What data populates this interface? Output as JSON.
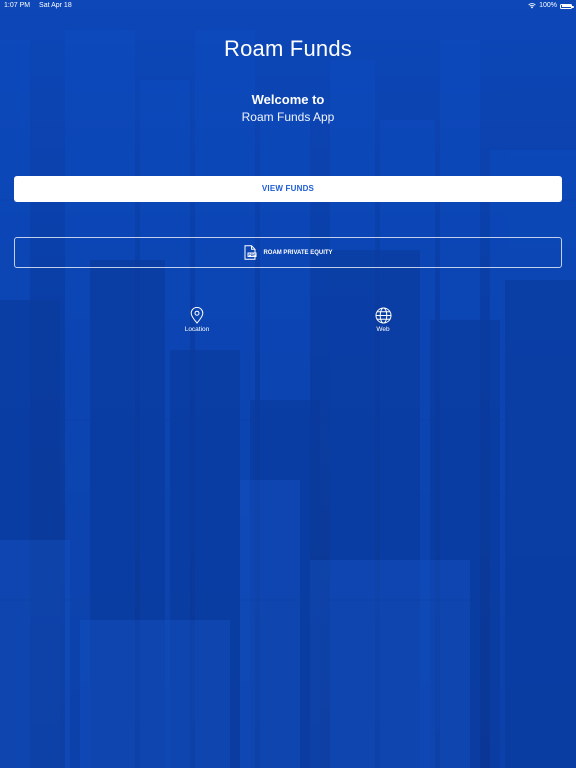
{
  "status_bar": {
    "time": "1:07 PM",
    "date": "Sat Apr 18",
    "battery": "100%"
  },
  "app": {
    "logo_text": "Roam Funds",
    "welcome": "Welcome to",
    "subtitle": "Roam Funds App"
  },
  "actions": {
    "view_funds": "VIEW FUNDS",
    "private_equity": "ROAM PRIVATE EQUITY"
  },
  "quick_links": {
    "location": "Location",
    "web": "Web"
  },
  "icons": {
    "wifi": "wifi-icon",
    "battery": "battery-icon",
    "pdf": "pdf-document-icon",
    "location": "map-pin-icon",
    "web": "globe-icon"
  },
  "colors": {
    "background": "#0a3fa8",
    "button_bg": "#ffffff",
    "button_text": "#1e5dd6"
  }
}
